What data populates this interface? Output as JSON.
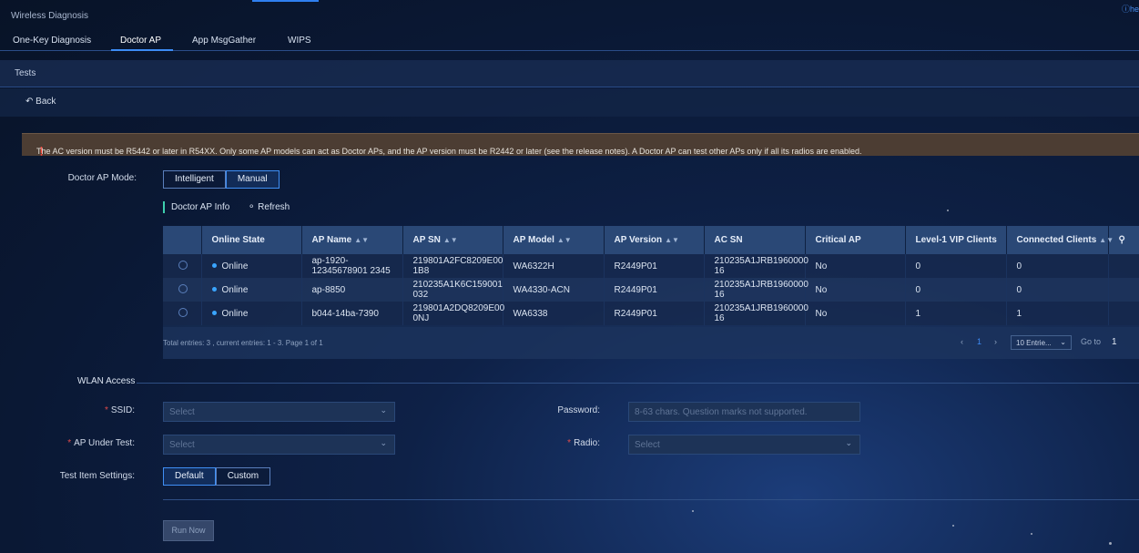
{
  "app": {
    "title": "Wireless Diagnosis",
    "help": "ⓘhe"
  },
  "tabs": [
    {
      "label": "One-Key Diagnosis"
    },
    {
      "label": "Doctor AP"
    },
    {
      "label": "App MsgGather"
    },
    {
      "label": "WIPS"
    }
  ],
  "tests_label": "Tests",
  "back_label": "Back",
  "notice": "The AC version must be R5442 or later in R54XX. Only some AP models can act as Doctor APs, and the AP version must be R2442 or later (see the release notes). A Doctor AP can test other APs only if all its radios are enabled.",
  "mode": {
    "label": "Doctor AP Mode",
    "options": [
      "Intelligent",
      "Manual"
    ],
    "selected": "Manual"
  },
  "info": {
    "title": "Doctor AP Info",
    "refresh": "Refresh"
  },
  "table": {
    "columns": [
      "Online State",
      "AP Name",
      "AP SN",
      "AP Model",
      "AP Version",
      "AC SN",
      "Critical AP",
      "Level-1 VIP Clients",
      "Connected Clients"
    ],
    "rows": [
      {
        "state": "Online",
        "name": "ap-1920-12345678901 2345",
        "sn": "219801A2FC8209E00 1B8",
        "model": "WA6322H",
        "version": "R2449P01",
        "ac_sn": "210235A1JRB1960000 16",
        "critical": "No",
        "vip": "0",
        "clients": "0"
      },
      {
        "state": "Online",
        "name": "ap-8850",
        "sn": "210235A1K6C159001 032",
        "model": "WA4330-ACN",
        "version": "R2449P01",
        "ac_sn": "210235A1JRB1960000 16",
        "critical": "No",
        "vip": "0",
        "clients": "0"
      },
      {
        "state": "Online",
        "name": "b044-14ba-7390",
        "sn": "219801A2DQ8209E00 0NJ",
        "model": "WA6338",
        "version": "R2449P01",
        "ac_sn": "210235A1JRB1960000 16",
        "critical": "No",
        "vip": "1",
        "clients": "1"
      }
    ],
    "footer": "Total entries: 3 , current entries: 1 - 3. Page 1 of 1",
    "page": "1",
    "entries_select": "10 Entrie...",
    "goto_label": "Go to",
    "goto_value": "1"
  },
  "wlan": {
    "title": "WLAN Access",
    "ssid_label": "SSID",
    "ssid_placeholder": "Select",
    "password_label": "Password",
    "password_placeholder": "8-63 chars. Question marks not supported.",
    "ap_label": "AP Under Test",
    "ap_placeholder": "Select",
    "radio_label": "Radio",
    "radio_placeholder": "Select",
    "test_label": "Test Item Settings",
    "test_options": [
      "Default",
      "Custom"
    ],
    "test_selected": "Default",
    "run_label": "Run Now"
  },
  "colors": {
    "accent": "#3c8cf5",
    "online": "#3aa5ff",
    "required": "#e24b4b",
    "notice_bg": "#4c3d33"
  }
}
